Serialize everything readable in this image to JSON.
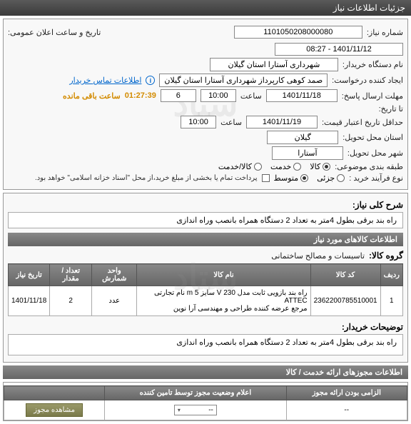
{
  "header": {
    "title": "جزئیات اطلاعات نیاز"
  },
  "info": {
    "need_no_label": "شماره نیاز:",
    "need_no": "1101050208000080",
    "announce_label": "تاریخ و ساعت اعلان عمومی:",
    "announce_value": "1401/11/12 - 08:27",
    "buyer_label": "نام دستگاه خریدار:",
    "buyer_value": "شهرداری آستارا استان گیلان",
    "requester_label": "ایجاد کننده درخواست:",
    "requester_value": "صمد کوهی کارپرداز شهرداری آستارا استان گیلان",
    "contact_link": "اطلاعات تماس خریدار",
    "response_deadline_label": "مهلت ارسال پاسخ:",
    "date1": "1401/11/18",
    "saat": "ساعت",
    "time1": "10:00",
    "days_left": "6",
    "remaining_label": "ساعت باقی مانده",
    "remaining_time": "01:27:39",
    "until_label": "تا تاریخ:",
    "validity_label": "حداقل تاریخ اعتبار قیمت:",
    "date2": "1401/11/19",
    "time2": "10:00",
    "province_label": "استان محل تحویل:",
    "province": "گیلان",
    "city_label": "شهر محل تحویل:",
    "city": "آستارا",
    "category_label": "طبقه بندی موضوعی:",
    "cat_goods": "کالا",
    "cat_service": "خدمت",
    "cat_both": "کالا/خدمت",
    "purchase_type_label": "نوع فرآیند خرید :",
    "pt_small": "جزئی",
    "pt_medium": "متوسط",
    "pt_note": "پرداخت تمام یا بخشی از مبلغ خرید،از محل \"اسناد خزانه اسلامی\" خواهد بود."
  },
  "desc": {
    "title_label": "شرح کلی نیاز:",
    "title_value": "راه بند برقی بطول 4متر به تعداد 2 دستگاه همراه بانصب وراه اندازی",
    "items_header": "اطلاعات کالاهای مورد نیاز",
    "group_label": "گروه کالا:",
    "group_value": "تاسیسات و مصالح ساختمانی",
    "buyer_note_label": "توضیحات خریدار:",
    "buyer_note_value": "راه بند برقی بطول 4متر به تعداد 2 دستگاه همراه بانصب وراه اندازی"
  },
  "table": {
    "headers": [
      "ردیف",
      "کد کالا",
      "نام کالا",
      "واحد شمارش",
      "تعداد / مقدار",
      "تاریخ نیاز"
    ],
    "rows": [
      {
        "idx": "1",
        "code": "2362200785510001",
        "name": "راه بند بازویی ثابت مدل 230 V سایز 5 m نام تجارتی ATTEC\nمرجع عرضه کننده طراحی و مهندسی آرا نوین",
        "unit": "عدد",
        "qty": "2",
        "date": "1401/11/18"
      }
    ]
  },
  "permit": {
    "header": "اطلاعات مجوزهای ارائه خدمت / کالا",
    "table_headers": [
      "الزامی بودن ارائه مجوز",
      "اعلام وضعیت مجوز توسط تامین کننده",
      ""
    ],
    "row": {
      "c1": "--",
      "c2": "--",
      "btn": "مشاهده مجوز"
    }
  },
  "watermark": "ستاد"
}
